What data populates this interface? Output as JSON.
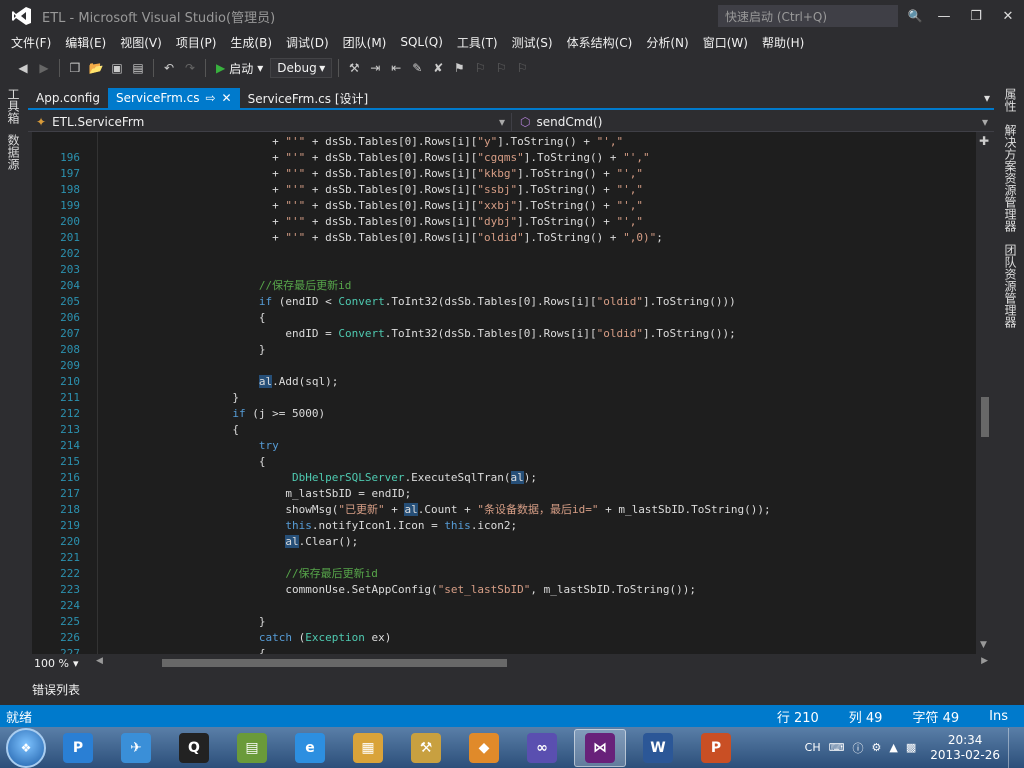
{
  "window": {
    "title": "ETL - Microsoft Visual Studio(管理员)",
    "quick_launch_placeholder": "快速启动 (Ctrl+Q)"
  },
  "menu": [
    "文件(F)",
    "编辑(E)",
    "视图(V)",
    "项目(P)",
    "生成(B)",
    "调试(D)",
    "团队(M)",
    "SQL(Q)",
    "工具(T)",
    "测试(S)",
    "体系结构(C)",
    "分析(N)",
    "窗口(W)",
    "帮助(H)"
  ],
  "toolbar": {
    "start_label": "启动",
    "config_value": "Debug"
  },
  "left_panels": [
    "工具箱",
    "数据源"
  ],
  "right_panels": [
    "属性",
    "解决方案资源管理器",
    "团队资源管理器"
  ],
  "tabs": [
    {
      "label": "App.config",
      "active": false
    },
    {
      "label": "ServiceFrm.cs",
      "active": true
    },
    {
      "label": "ServiceFrm.cs [设计]",
      "active": false
    }
  ],
  "nav": {
    "class": "ETL.ServiceFrm",
    "member": "sendCmd()"
  },
  "code_lines": [
    {
      "num": "",
      "indent": 26,
      "text": "+ \"'\" + dsSb.Tables[0].Rows[i][\"y\"].ToString() + \"',\""
    },
    {
      "num": "196",
      "indent": 26,
      "text": "+ \"'\" + dsSb.Tables[0].Rows[i][\"cgqms\"].ToString() + \"',\""
    },
    {
      "num": "197",
      "indent": 26,
      "text": "+ \"'\" + dsSb.Tables[0].Rows[i][\"kkbg\"].ToString() + \"',\""
    },
    {
      "num": "198",
      "indent": 26,
      "text": "+ \"'\" + dsSb.Tables[0].Rows[i][\"ssbj\"].ToString() + \"',\""
    },
    {
      "num": "199",
      "indent": 26,
      "text": "+ \"'\" + dsSb.Tables[0].Rows[i][\"xxbj\"].ToString() + \"',\""
    },
    {
      "num": "200",
      "indent": 26,
      "text": "+ \"'\" + dsSb.Tables[0].Rows[i][\"dybj\"].ToString() + \"',\""
    },
    {
      "num": "201",
      "indent": 26,
      "text": "+ \"'\" + dsSb.Tables[0].Rows[i][\"oldid\"].ToString() + \",0)\";"
    },
    {
      "num": "202",
      "indent": 0,
      "text": ""
    },
    {
      "num": "203",
      "indent": 0,
      "text": ""
    },
    {
      "num": "204",
      "indent": 24,
      "text": "//保存最后更新id"
    },
    {
      "num": "205",
      "indent": 24,
      "text": "if (endID < Convert.ToInt32(dsSb.Tables[0].Rows[i][\"oldid\"].ToString()))"
    },
    {
      "num": "206",
      "indent": 24,
      "text": "{"
    },
    {
      "num": "207",
      "indent": 28,
      "text": "endID = Convert.ToInt32(dsSb.Tables[0].Rows[i][\"oldid\"].ToString());"
    },
    {
      "num": "208",
      "indent": 24,
      "text": "}"
    },
    {
      "num": "209",
      "indent": 0,
      "text": ""
    },
    {
      "num": "210",
      "indent": 24,
      "text": "al.Add(sql);"
    },
    {
      "num": "211",
      "indent": 20,
      "text": "}"
    },
    {
      "num": "212",
      "indent": 20,
      "text": "if (j >= 5000)"
    },
    {
      "num": "213",
      "indent": 20,
      "text": "{"
    },
    {
      "num": "214",
      "indent": 24,
      "text": "try"
    },
    {
      "num": "215",
      "indent": 24,
      "text": "{"
    },
    {
      "num": "216",
      "indent": 29,
      "text": "DbHelperSQLServer.ExecuteSqlTran(al);"
    },
    {
      "num": "217",
      "indent": 28,
      "text": "m_lastSbID = endID;"
    },
    {
      "num": "218",
      "indent": 28,
      "text": "showMsg(\"已更新\" + al.Count + \"条设备数据，最后id=\" + m_lastSbID.ToString());"
    },
    {
      "num": "219",
      "indent": 28,
      "text": "this.notifyIcon1.Icon = this.icon2;"
    },
    {
      "num": "220",
      "indent": 28,
      "text": "al.Clear();"
    },
    {
      "num": "221",
      "indent": 0,
      "text": ""
    },
    {
      "num": "222",
      "indent": 28,
      "text": "//保存最后更新id"
    },
    {
      "num": "223",
      "indent": 28,
      "text": "commonUse.SetAppConfig(\"set_lastSbID\", m_lastSbID.ToString());"
    },
    {
      "num": "224",
      "indent": 0,
      "text": ""
    },
    {
      "num": "225",
      "indent": 24,
      "text": "}"
    },
    {
      "num": "226",
      "indent": 24,
      "text": "catch (Exception ex)"
    },
    {
      "num": "227",
      "indent": 24,
      "text": "{"
    }
  ],
  "zoom": "100 %",
  "error_panel": "错误列表",
  "status": {
    "ready": "就绪",
    "line": "行 210",
    "col": "列 49",
    "char": "字符 49",
    "mode": "Ins"
  },
  "tray": {
    "lang": "CH",
    "time": "20:34",
    "date": "2013-02-26"
  },
  "taskbar_apps": [
    {
      "name": "presentation-app-icon",
      "glyph": "P",
      "color": "#2a7fd4"
    },
    {
      "name": "bird-app-icon",
      "glyph": "✈",
      "color": "#3a8fd8"
    },
    {
      "name": "qq-icon",
      "glyph": "Q",
      "color": "#222"
    },
    {
      "name": "database-app-icon",
      "glyph": "▤",
      "color": "#6a9a3a"
    },
    {
      "name": "internet-explorer-icon",
      "glyph": "e",
      "color": "#2d8fe0"
    },
    {
      "name": "file-explorer-icon",
      "glyph": "▦",
      "color": "#d9a33a"
    },
    {
      "name": "tools-app-icon",
      "glyph": "⚒",
      "color": "#c8a040"
    },
    {
      "name": "color-app-icon",
      "glyph": "◆",
      "color": "#e08a2a"
    },
    {
      "name": "infinity-app-icon",
      "glyph": "∞",
      "color": "#5a4fb0"
    },
    {
      "name": "visual-studio-icon",
      "glyph": "⋈",
      "color": "#68217a"
    },
    {
      "name": "word-icon",
      "glyph": "W",
      "color": "#2b5797"
    },
    {
      "name": "powerpoint-icon",
      "glyph": "P",
      "color": "#c94f24"
    }
  ]
}
